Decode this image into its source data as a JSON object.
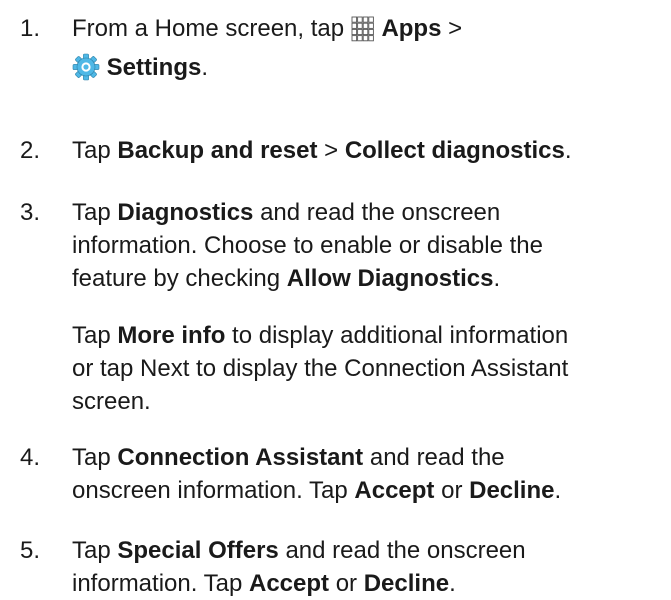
{
  "steps": [
    {
      "number": "1.",
      "lines": [
        [
          {
            "t": "From a Home screen, tap "
          },
          {
            "icon": "apps-grid-icon"
          },
          {
            "t": " "
          },
          {
            "t": "Apps",
            "b": true
          },
          {
            "t": " >"
          }
        ],
        [
          {
            "icon": "settings-gear-icon"
          },
          {
            "t": " "
          },
          {
            "t": "Settings",
            "b": true
          },
          {
            "t": "."
          }
        ]
      ]
    },
    {
      "number": "2.",
      "lines": [
        [
          {
            "t": "Tap "
          },
          {
            "t": "Backup and reset",
            "b": true
          },
          {
            "t": " > "
          },
          {
            "t": "Collect diagnostics",
            "b": true
          },
          {
            "t": "."
          }
        ]
      ]
    },
    {
      "number": "3.",
      "lines": [
        [
          {
            "t": "Tap "
          },
          {
            "t": "Diagnostics",
            "b": true
          },
          {
            "t": " and read the onscreen"
          }
        ],
        [
          {
            "t": "information. Choose to enable or disable the"
          }
        ],
        [
          {
            "t": "feature by checking "
          },
          {
            "t": "Allow Diagnostics",
            "b": true
          },
          {
            "t": "."
          }
        ]
      ]
    },
    {
      "number": "",
      "lines": [
        [
          {
            "t": "Tap "
          },
          {
            "t": "More info",
            "b": true
          },
          {
            "t": " to display additional information"
          }
        ],
        [
          {
            "t": "or tap Next to display the Connection Assistant"
          }
        ],
        [
          {
            "t": "screen."
          }
        ]
      ]
    },
    {
      "number": "4.",
      "lines": [
        [
          {
            "t": "Tap "
          },
          {
            "t": "Connection Assistant",
            "b": true
          },
          {
            "t": " and read the"
          }
        ],
        [
          {
            "t": "onscreen information. Tap "
          },
          {
            "t": "Accept",
            "b": true
          },
          {
            "t": " or "
          },
          {
            "t": "Decline",
            "b": true
          },
          {
            "t": "."
          }
        ]
      ]
    },
    {
      "number": "5.",
      "lines": [
        [
          {
            "t": "Tap "
          },
          {
            "t": "Special Offers",
            "b": true
          },
          {
            "t": " and read the onscreen"
          }
        ],
        [
          {
            "t": "information. Tap "
          },
          {
            "t": "Accept",
            "b": true
          },
          {
            "t": " or "
          },
          {
            "t": "Decline",
            "b": true
          },
          {
            "t": "."
          }
        ]
      ]
    }
  ],
  "colors": {
    "text": "#1a1a1a",
    "icon_stroke": "#555555",
    "settings_icon_fill": "#4fb8e6"
  }
}
